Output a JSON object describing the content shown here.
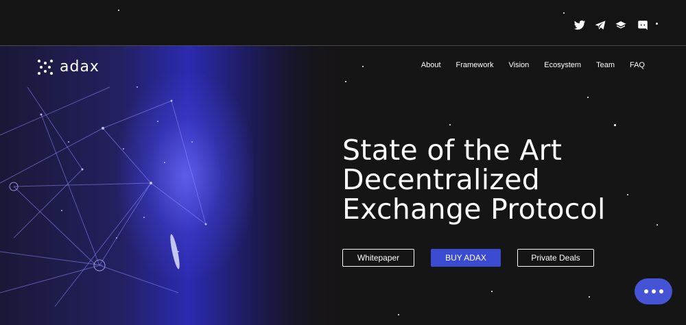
{
  "social": {
    "icons": [
      "twitter-icon",
      "telegram-icon",
      "medium-icon",
      "discord-icon"
    ]
  },
  "logo": {
    "text": "adax"
  },
  "nav": {
    "items": [
      {
        "label": "About"
      },
      {
        "label": "Framework"
      },
      {
        "label": "Vision"
      },
      {
        "label": "Ecosystem"
      },
      {
        "label": "Team"
      },
      {
        "label": "FAQ"
      }
    ]
  },
  "hero": {
    "headline_line1": "State of the Art",
    "headline_line2": "Decentralized",
    "headline_line3": "Exchange Protocol",
    "buttons": {
      "whitepaper": "Whitepaper",
      "buy": "BUY ADAX",
      "private_deals": "Private Deals"
    }
  },
  "colors": {
    "background": "#151415",
    "accent": "#3b4bd1",
    "chat": "#4454d4"
  },
  "chat": {
    "icon": "chat-dots-icon"
  }
}
